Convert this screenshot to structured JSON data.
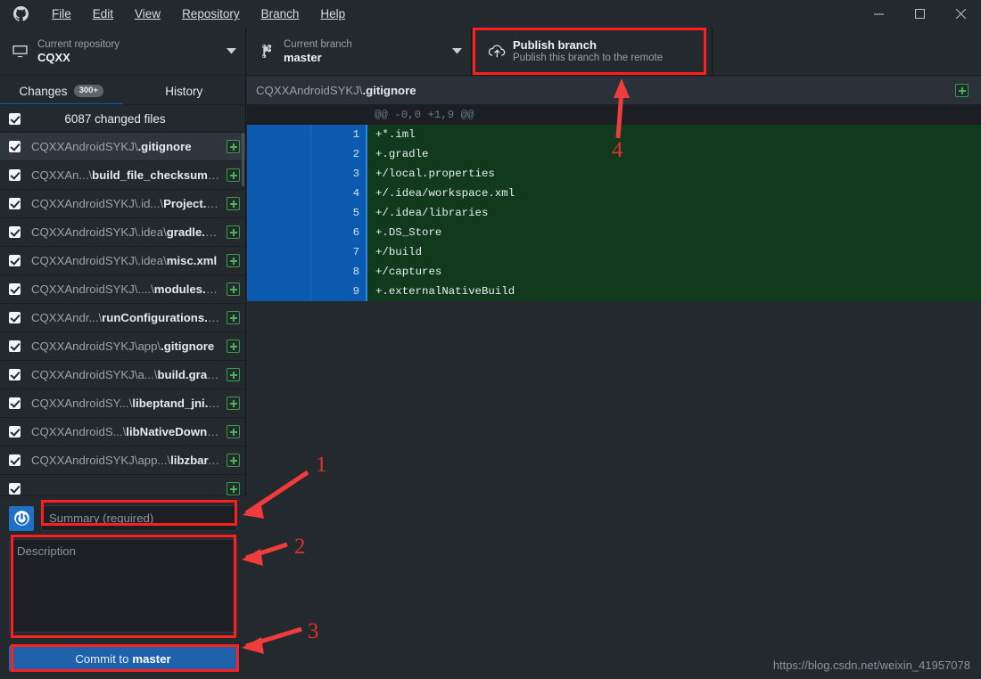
{
  "window": {
    "app_title": "GitHub Desktop",
    "menu": [
      "File",
      "Edit",
      "View",
      "Repository",
      "Branch",
      "Help"
    ],
    "controls": [
      "minimize",
      "maximize",
      "close"
    ]
  },
  "toolbar": {
    "repository": {
      "label": "Current repository",
      "value": "CQXX",
      "icon": "repository-icon"
    },
    "branch": {
      "label": "Current branch",
      "value": "master",
      "icon": "branch-icon"
    },
    "publish": {
      "title": "Publish branch",
      "subtitle": "Publish this branch to the remote",
      "icon": "cloud-upload-icon"
    }
  },
  "sidebar": {
    "tabs": [
      {
        "label": "Changes",
        "badge": "300+",
        "active": true
      },
      {
        "label": "History",
        "badge": "",
        "active": false
      }
    ],
    "summary_row": {
      "text": "6087 changed files",
      "checked": true
    },
    "files": [
      {
        "prefix": "CQXXAndroidSYKJ\\",
        "name": ".gitignore",
        "status": "added",
        "selected": true
      },
      {
        "prefix": "CQXXAn...\\",
        "name": "build_file_checksums.ser",
        "status": "added",
        "selected": false
      },
      {
        "prefix": "CQXXAndroidSYKJ\\.id...\\",
        "name": "Project.xml",
        "status": "added",
        "selected": false
      },
      {
        "prefix": "CQXXAndroidSYKJ\\.idea\\",
        "name": "gradle.xml",
        "status": "added",
        "selected": false
      },
      {
        "prefix": "CQXXAndroidSYKJ\\.idea\\",
        "name": "misc.xml",
        "status": "added",
        "selected": false
      },
      {
        "prefix": "CQXXAndroidSYKJ\\....\\",
        "name": "modules.xml",
        "status": "added",
        "selected": false
      },
      {
        "prefix": "CQXXAndr...\\",
        "name": "runConfigurations.xml",
        "status": "added",
        "selected": false
      },
      {
        "prefix": "CQXXAndroidSYKJ\\app\\",
        "name": ".gitignore",
        "status": "added",
        "selected": false
      },
      {
        "prefix": "CQXXAndroidSYKJ\\a...\\",
        "name": "build.gradle",
        "status": "added",
        "selected": false
      },
      {
        "prefix": "CQXXAndroidSY...\\",
        "name": "libeptand_jni.so",
        "status": "added",
        "selected": false
      },
      {
        "prefix": "CQXXAndroidS...\\",
        "name": "libNativeDown.so",
        "status": "added",
        "selected": false
      },
      {
        "prefix": "CQXXAndroidSYKJ\\app...\\",
        "name": "libzbar.so",
        "status": "added",
        "selected": false
      },
      {
        "prefix": "",
        "name": "",
        "status": "added",
        "selected": false
      }
    ]
  },
  "commit": {
    "avatar_icon": "gravatar-avatar",
    "summary_placeholder": "Summary (required)",
    "summary_value": "",
    "description_placeholder": "Description",
    "description_value": "",
    "button_prefix": "Commit to ",
    "button_branch": "master"
  },
  "diff": {
    "file_prefix": "CQXXAndroidSYKJ\\",
    "file_name": ".gitignore",
    "expand_icon": "add-square-icon",
    "hunk_header": "@@ -0,0 +1,9 @@",
    "lines": [
      {
        "num": "1",
        "text": "+*.iml"
      },
      {
        "num": "2",
        "text": "+.gradle"
      },
      {
        "num": "3",
        "text": "+/local.properties"
      },
      {
        "num": "4",
        "text": "+/.idea/workspace.xml"
      },
      {
        "num": "5",
        "text": "+/.idea/libraries"
      },
      {
        "num": "6",
        "text": "+.DS_Store"
      },
      {
        "num": "7",
        "text": "+/build"
      },
      {
        "num": "8",
        "text": "+/captures"
      },
      {
        "num": "9",
        "text": "+.externalNativeBuild"
      }
    ]
  },
  "annotations": {
    "numbers": [
      "1",
      "2",
      "3",
      "4"
    ],
    "color": "#e0312b",
    "highlight_color": "#ff1f1f"
  },
  "watermark": {
    "text": "https://blog.csdn.net/weixin_41957078"
  },
  "colors": {
    "app_background": "#24292e",
    "accent_blue": "#0366d6",
    "diff_add_background": "#113a1c",
    "gutter_blue": "#0c5aaf",
    "commit_button": "#1f62ac",
    "status_add_green": "#3fb950"
  }
}
